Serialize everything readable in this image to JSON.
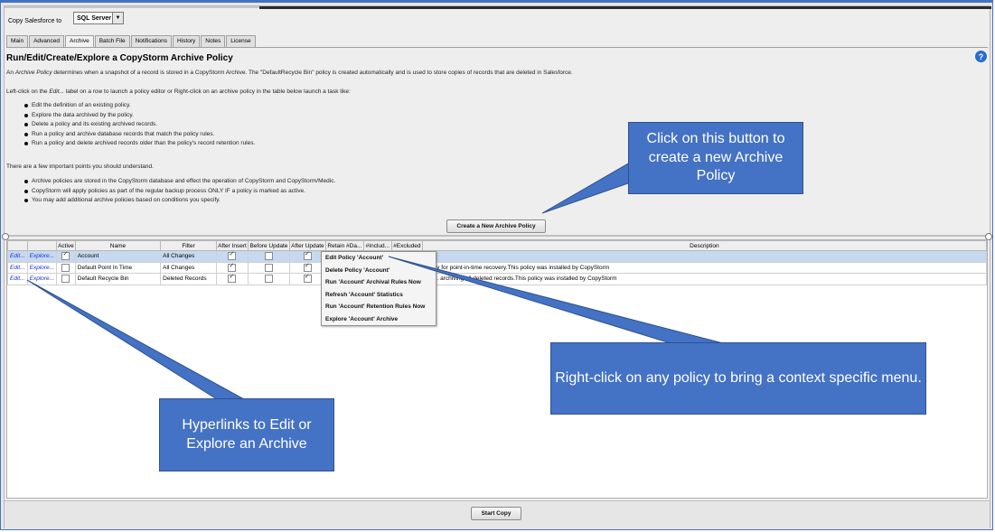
{
  "copy_bar": {
    "label": "Copy Salesforce to",
    "selected": "SQL Server"
  },
  "tabs": [
    "Main",
    "Advanced",
    "Archive",
    "Batch File",
    "Notifications",
    "History",
    "Notes",
    "License"
  ],
  "active_tab": "Archive",
  "page": {
    "title": "Run/Edit/Create/Explore a CopyStorm Archive Policy",
    "intro_a": "An ",
    "intro_em": "Archive Policy",
    "intro_b": " determines when a snapshot of a record is stored in a CopyStorm Archive. The \"DefaultRecycle Bin\" policy is created automatically and is used to store copies of records that are deleted in Salesforce.",
    "instr_a": "Left-click on the ",
    "instr_em": "Edit...",
    "instr_b": " label on a row to launch a policy editor or Right-click on an archive policy in the table below launch a task like:",
    "tasks": [
      "Edit the definition of an existing policy.",
      "Explore the data archived by the policy.",
      "Delete a policy and its existing archived records.",
      "Run a policy and archive database records that match the policy rules.",
      "Run a policy and delete archived records older than the policy's record retention rules."
    ],
    "points_heading": "There are a few important points you should understand.",
    "points": [
      "Archive policies are stored in the CopyStorm database and effect the operation of CopyStorm and CopyStorm/Medic.",
      "CopyStorm will apply policies as part of the regular backup process ONLY IF a policy is marked as active.",
      "You may add additional archive policies based on conditions you specify."
    ],
    "create_button": "Create a New Archive Policy",
    "help_icon": "?"
  },
  "table": {
    "headers": [
      "",
      "",
      "Active",
      "Name",
      "Filter",
      "After Insert",
      "Before Update",
      "After Update",
      "Retain #Da...",
      "#Includ...",
      "#Excluded",
      "Description"
    ],
    "rows": [
      {
        "edit": "Edit...",
        "explore": "Explore...",
        "active": true,
        "name": "Account",
        "filter": "All Changes",
        "after_insert": true,
        "before_update": false,
        "after_update": true,
        "description": "",
        "selected": true
      },
      {
        "edit": "Edit...",
        "explore": "Explore...",
        "active": false,
        "name": "Default Point In Time",
        "filter": "All Changes",
        "after_insert": true,
        "before_update": false,
        "after_update": true,
        "description": "policy for point-in-time recovery.This policy was installed by CopyStorm",
        "selected": false
      },
      {
        "edit": "Edit...",
        "explore": "Explore...",
        "active": false,
        "name": "Default Recycle Bin",
        "filter": "Deleted Records",
        "after_insert": true,
        "before_update": false,
        "after_update": true,
        "description": "poli... archiving all deleted records.This policy was installed by CopyStorm",
        "selected": false
      }
    ]
  },
  "context_menu": [
    "Edit Policy 'Account'",
    "Delete Policy 'Account'",
    "Run 'Account' Archival Rules Now",
    "Refresh 'Account' Statistics",
    "Run 'Account' Retention Rules Now",
    "Explore 'Account' Archive"
  ],
  "start_button": "Start Copy",
  "callouts": {
    "create": "Click on this button to create a new Archive Policy",
    "context": "Right-click on any policy to bring a context specific menu.",
    "hyperlinks": "Hyperlinks to Edit or Explore an Archive"
  },
  "colors": {
    "callout": "#4472c4",
    "link": "#1a32d8",
    "selection": "#c6d9f0"
  }
}
